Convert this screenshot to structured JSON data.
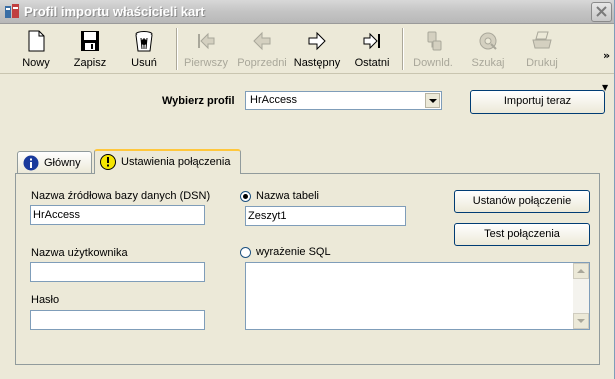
{
  "window": {
    "title": "Profil importu właścicieli kart"
  },
  "toolbar": {
    "new": "Nowy",
    "save": "Zapisz",
    "delete": "Usuń",
    "first": "Pierwszy",
    "prev": "Poprzedni",
    "next": "Następny",
    "last": "Ostatni",
    "download": "Downld.",
    "search": "Szukaj",
    "print": "Drukuj",
    "overflow": "»"
  },
  "profile": {
    "label": "Wybierz profil",
    "selected": "HrAccess",
    "import_button": "Importuj teraz"
  },
  "tabs": [
    {
      "label": "Główny",
      "icon": "info-icon",
      "active": false
    },
    {
      "label": "Ustawienia połączenia",
      "icon": "warning-icon",
      "active": true
    }
  ],
  "connection": {
    "dsn_label": "Nazwa źródłowa bazy danych (DSN)",
    "dsn_value": "HrAccess",
    "user_label": "Nazwa użytkownika",
    "user_value": "",
    "password_label": "Hasło",
    "password_value": "",
    "table_radio_label": "Nazwa tabeli",
    "table_value": "Zeszyt1",
    "sql_radio_label": "wyrażenie SQL",
    "sql_value": "",
    "set_connection_button": "Ustanów połączenie",
    "test_connection_button": "Test połączenia"
  },
  "colors": {
    "window_bg": "#ece9d8",
    "title_text": "#ffffff",
    "disabled_text": "#a9a79a",
    "tab_highlight": "#ffc73c"
  }
}
